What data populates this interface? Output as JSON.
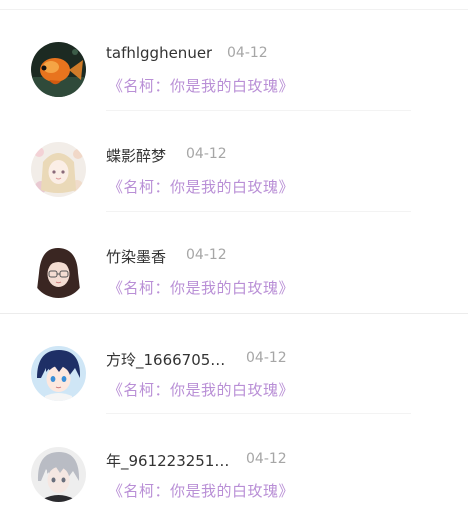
{
  "conversations": [
    {
      "name": "tafhlgghenuer",
      "date": "04-12",
      "message": "《名柯：你是我的白玫瑰》",
      "avatar_icon": "goldfish-avatar-icon"
    },
    {
      "name": "蝶影醉梦",
      "date": "04-12",
      "message": "《名柯：你是我的白玫瑰》",
      "avatar_icon": "anime-girl-flowers-avatar-icon"
    },
    {
      "name": "竹染墨香",
      "date": "04-12",
      "message": "《名柯：你是我的白玫瑰》",
      "avatar_icon": "anime-girl-glasses-avatar-icon"
    },
    {
      "name": "方玲_1666705…",
      "date": "04-12",
      "message": "《名柯：你是我的白玫瑰》",
      "avatar_icon": "anime-boy-blue-avatar-icon"
    },
    {
      "name": "年_961223251…",
      "date": "04-12",
      "message": "《名柯：你是我的白玫瑰》",
      "avatar_icon": "anime-boy-silver-avatar-icon"
    }
  ],
  "colors": {
    "message": "#b98fd6",
    "name": "#333333",
    "date": "#a6a6a6"
  }
}
